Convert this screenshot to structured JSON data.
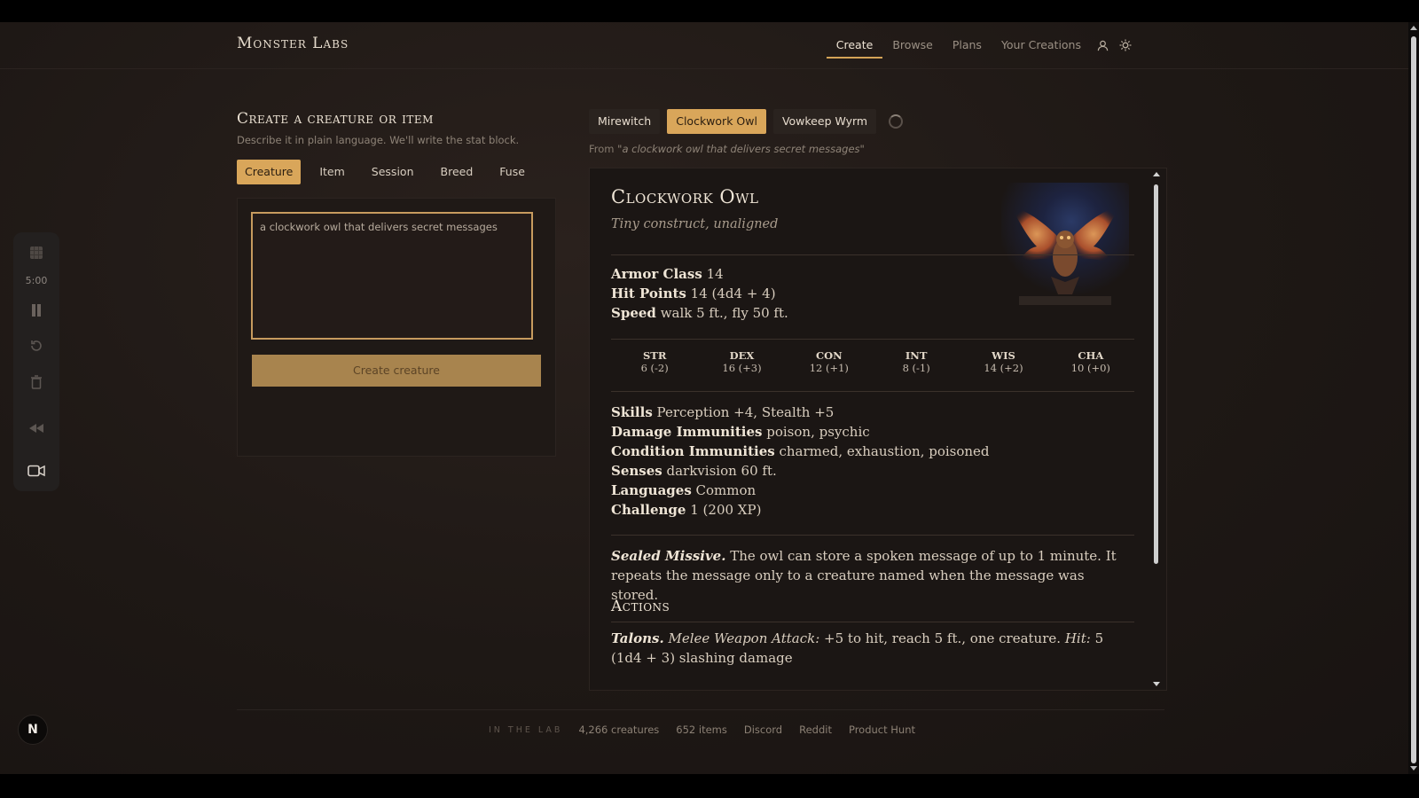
{
  "header": {
    "logo": "Monster Labs",
    "nav": [
      {
        "label": "Create",
        "active": true
      },
      {
        "label": "Browse",
        "active": false
      },
      {
        "label": "Plans",
        "active": false
      },
      {
        "label": "Your Creations",
        "active": false
      }
    ],
    "icons": [
      "user-icon",
      "sun-icon"
    ]
  },
  "create": {
    "title": "Create a creature or item",
    "subtitle": "Describe it in plain language. We'll write the stat block.",
    "modes": [
      "Creature",
      "Item",
      "Session",
      "Breed",
      "Fuse"
    ],
    "active_mode": "Creature",
    "prompt_value": "a clockwork owl that delivers secret messages",
    "button_label": "Create creature"
  },
  "variants": {
    "tabs": [
      "Mirewitch",
      "Clockwork Owl",
      "Vowkeep Wyrm"
    ],
    "active": "Clockwork Owl",
    "source_prefix": "From ",
    "source_quote": "\"a clockwork owl that delivers secret messages\""
  },
  "statblock": {
    "name": "Clockwork Owl",
    "type": "Tiny construct, unaligned",
    "armor_class_label": "Armor Class",
    "armor_class": "14",
    "hit_points_label": "Hit Points",
    "hit_points": "14 (4d4 + 4)",
    "speed_label": "Speed",
    "speed": "walk 5 ft., fly 50 ft.",
    "abilities": [
      {
        "key": "STR",
        "val": "6 (-2)"
      },
      {
        "key": "DEX",
        "val": "16 (+3)"
      },
      {
        "key": "CON",
        "val": "12 (+1)"
      },
      {
        "key": "INT",
        "val": "8 (-1)"
      },
      {
        "key": "WIS",
        "val": "14 (+2)"
      },
      {
        "key": "CHA",
        "val": "10 (+0)"
      }
    ],
    "skills_label": "Skills",
    "skills": "Perception +4, Stealth +5",
    "damage_imm_label": "Damage Immunities",
    "damage_imm": "poison, psychic",
    "condition_imm_label": "Condition Immunities",
    "condition_imm": "charmed, exhaustion, poisoned",
    "senses_label": "Senses",
    "senses": "darkvision 60 ft.",
    "languages_label": "Languages",
    "languages": "Common",
    "challenge_label": "Challenge",
    "challenge": "1 (200 XP)",
    "trait_name": "Sealed Missive.",
    "trait_text": "The owl can store a spoken message of up to 1 minute. It repeats the message only to a creature named when the message was stored.",
    "actions_heading": "Actions",
    "action_name": "Talons.",
    "action_type": "Melee Weapon Attack:",
    "action_text1": "+5 to hit, reach 5 ft., one creature.",
    "action_hit": "Hit:",
    "action_text2": "5 (1d4 + 3) slashing damage"
  },
  "toolbar": {
    "timer": "5:00",
    "icons": [
      "grid-icon",
      "pause-icon",
      "restart-icon",
      "trash-icon",
      "rewind-icon",
      "record-icon"
    ]
  },
  "badge": "N",
  "footer": {
    "label": "IN THE LAB",
    "creatures": "4,266 creatures",
    "items": "652 items",
    "links": [
      "Discord",
      "Reddit",
      "Product Hunt"
    ]
  }
}
